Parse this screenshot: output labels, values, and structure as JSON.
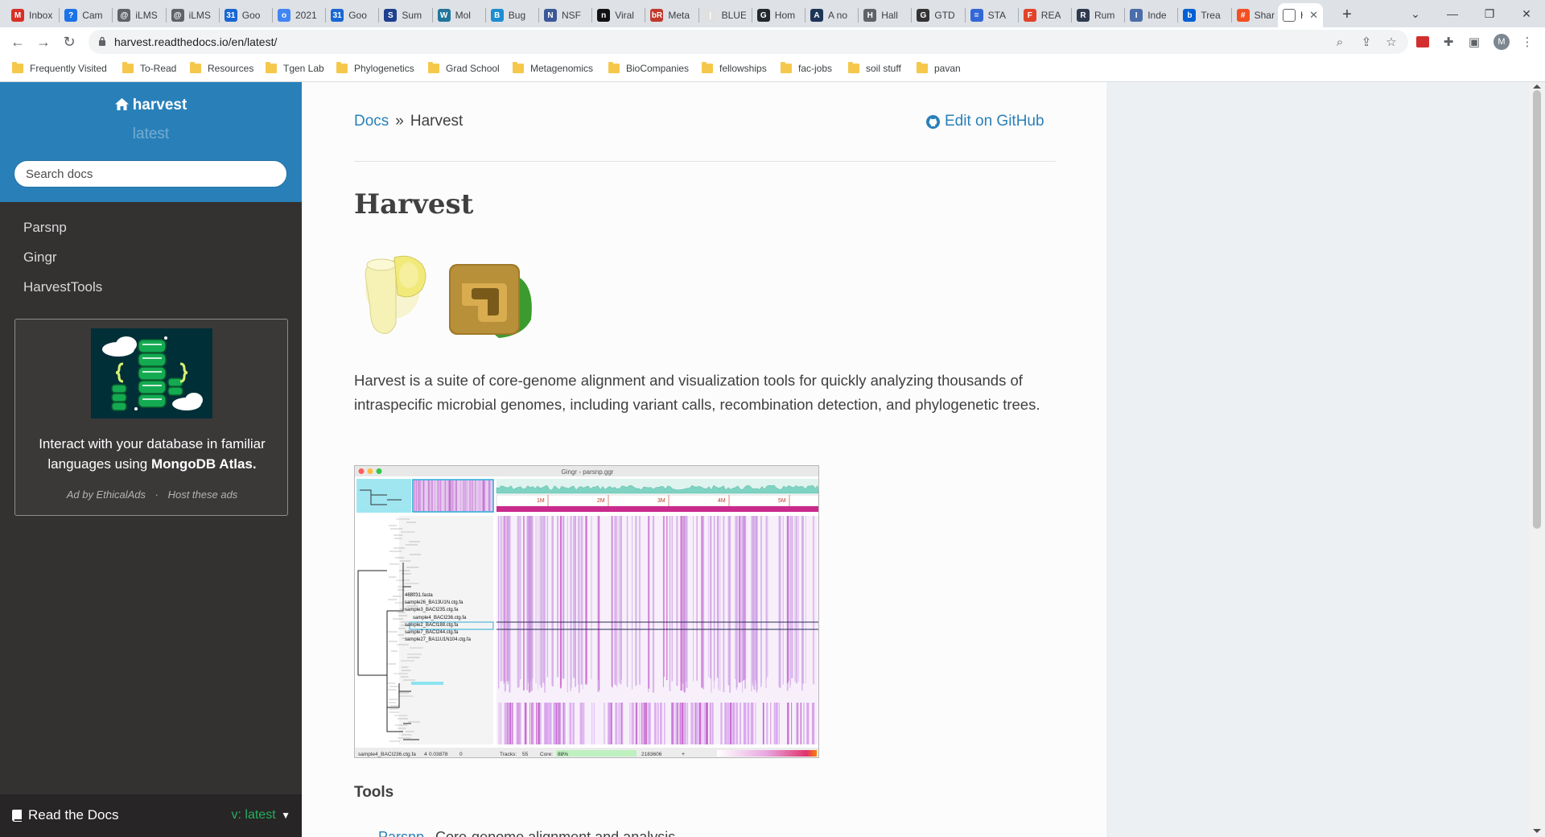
{
  "browser": {
    "tabs": [
      {
        "title": "Inbox",
        "color": "#d93025",
        "glyph": "M"
      },
      {
        "title": "Cam",
        "color": "#1a73e8",
        "glyph": "?"
      },
      {
        "title": "iLMS",
        "color": "#5f6368",
        "glyph": "@"
      },
      {
        "title": "iLMS",
        "color": "#5f6368",
        "glyph": "@"
      },
      {
        "title": "Goo",
        "color": "#1967d2",
        "glyph": "31"
      },
      {
        "title": "2021",
        "color": "#4285f4",
        "glyph": "o"
      },
      {
        "title": "Goo",
        "color": "#1967d2",
        "glyph": "31"
      },
      {
        "title": "Sum",
        "color": "#1f3f8f",
        "glyph": "S"
      },
      {
        "title": "Mol",
        "color": "#21759b",
        "glyph": "W"
      },
      {
        "title": "Bug",
        "color": "#1d8dd1",
        "glyph": "B"
      },
      {
        "title": "NSF",
        "color": "#3b5998",
        "glyph": "N"
      },
      {
        "title": "Viral",
        "color": "#111111",
        "glyph": "n"
      },
      {
        "title": "Meta",
        "color": "#c0392b",
        "glyph": "bR"
      },
      {
        "title": "BLUE",
        "color": "#e0e0e0",
        "glyph": "|"
      },
      {
        "title": "Hom",
        "color": "#24292e",
        "glyph": "G"
      },
      {
        "title": "A no",
        "color": "#1d3557",
        "glyph": "A"
      },
      {
        "title": "Hall",
        "color": "#5f6368",
        "glyph": "H"
      },
      {
        "title": "GTD",
        "color": "#333333",
        "glyph": "G"
      },
      {
        "title": "STA",
        "color": "#3367d6",
        "glyph": "="
      },
      {
        "title": "REA",
        "color": "#e24329",
        "glyph": "F"
      },
      {
        "title": "Rum",
        "color": "#2f3a4f",
        "glyph": "R"
      },
      {
        "title": "Inde",
        "color": "#4a6ea9",
        "glyph": "I"
      },
      {
        "title": "Trea",
        "color": "#0061d5",
        "glyph": "b"
      },
      {
        "title": "Shar",
        "color": "#f25022",
        "glyph": "#"
      }
    ],
    "active_tab": {
      "title": "H"
    },
    "new_tab": "+",
    "url": "harvest.readthedocs.io/en/latest/",
    "profile_initial": "M",
    "bookmarks": [
      "Frequently Visited",
      "To-Read",
      "Resources",
      "Tgen Lab",
      "Phylogenetics",
      "Grad School",
      "Metagenomics",
      "BioCompanies",
      "fellowships",
      "fac-jobs",
      "soil stuff",
      "pavan"
    ]
  },
  "sidebar": {
    "project": "harvest",
    "version": "latest",
    "search_placeholder": "Search docs",
    "nav": [
      "Parsnp",
      "Gingr",
      "HarvestTools"
    ],
    "ad": {
      "text_plain": "Interact with your database in familiar languages using",
      "text_bold": "MongoDB Atlas.",
      "by": "Ad by EthicalAds",
      "dot": "·",
      "host": "Host these ads"
    },
    "footer": {
      "name": "Read the Docs",
      "version": "v: latest"
    }
  },
  "main": {
    "breadcrumb_root": "Docs",
    "breadcrumb_sep": "»",
    "breadcrumb_current": "Harvest",
    "edit_link": "Edit on GitHub",
    "title": "Harvest",
    "intro": "Harvest is a suite of core-genome alignment and visualization tools for quickly analyzing thousands of intraspecific microbial genomes, including variant calls, recombination detection, and phylogenetic trees.",
    "screenshot": {
      "window_title": "Gingr - parsnp.ggr",
      "ticks": [
        "1M",
        "2M",
        "3M",
        "4M",
        "5M"
      ],
      "tree_labels": [
        "468031.fasta",
        "sample26_BA13U1N.ctg.fa",
        "sample3_BACI235.ctg.fa",
        "sample4_BACI236.ctg.fa",
        "sample2_BACI188.ctg.fa",
        "sample7_BACI244.ctg.fa",
        "sample27_BA11U1N104.ctg.fa"
      ],
      "status_left": "sample4_BACI236.ctg.fa",
      "status_val1": "4",
      "status_val2": "0.03878",
      "status_val3": "0",
      "status_tracks_label": "Tracks:",
      "status_tracks": "55",
      "status_core_label": "Core:",
      "status_core": "88%",
      "status_pos": "2183606",
      "status_plus": "+"
    },
    "tools_heading": "Tools",
    "peek_link": "Parsnp",
    "peek_text": "Core-genome alignment and analysis"
  },
  "colors": {
    "rtd_blue": "#2980b9",
    "sidebar_dark": "#343131",
    "link": "#2980b9",
    "version_green": "#27ae60"
  }
}
